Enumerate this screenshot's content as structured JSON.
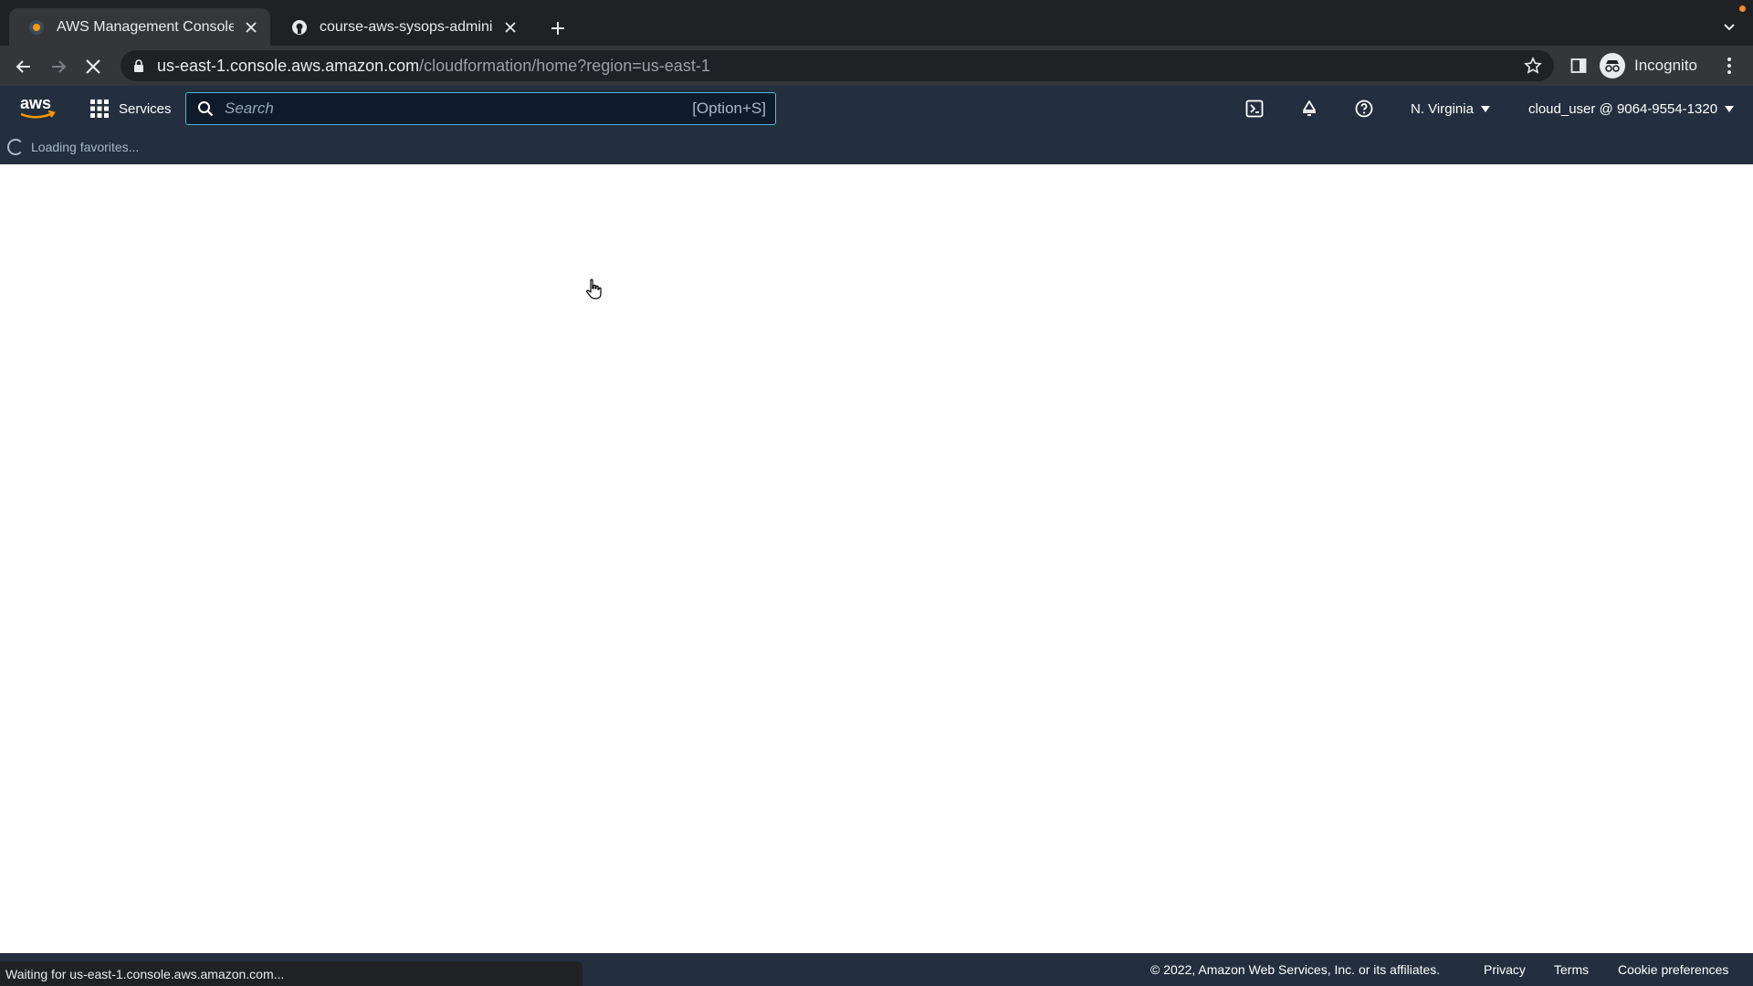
{
  "browser": {
    "tabs": [
      {
        "title": "AWS Management Console",
        "favicon": "aws-favicon-icon",
        "active": true
      },
      {
        "title": "course-aws-sysops-administrat",
        "favicon": "github-icon",
        "active": false
      }
    ],
    "url_host": "us-east-1.console.aws.amazon.com",
    "url_path": "/cloudformation/home?region=us-east-1",
    "profile_label": "Incognito",
    "status_text": "Waiting for us-east-1.console.aws.amazon.com..."
  },
  "aws": {
    "logo_text": "aws",
    "services_label": "Services",
    "search": {
      "placeholder": "Search",
      "shortcut": "[Option+S]"
    },
    "region_label": "N. Virginia",
    "account_label": "cloud_user @ 9064-9554-1320",
    "favorites_text": "Loading favorites..."
  },
  "footer": {
    "copyright": "© 2022, Amazon Web Services, Inc. or its affiliates.",
    "links": [
      "Privacy",
      "Terms",
      "Cookie preferences"
    ]
  },
  "colors": {
    "aws_nav": "#232f3e",
    "aws_orange": "#ff9900",
    "search_focus": "#44b9d6",
    "chrome_dark": "#202124",
    "chrome_toolbar": "#35363a"
  }
}
